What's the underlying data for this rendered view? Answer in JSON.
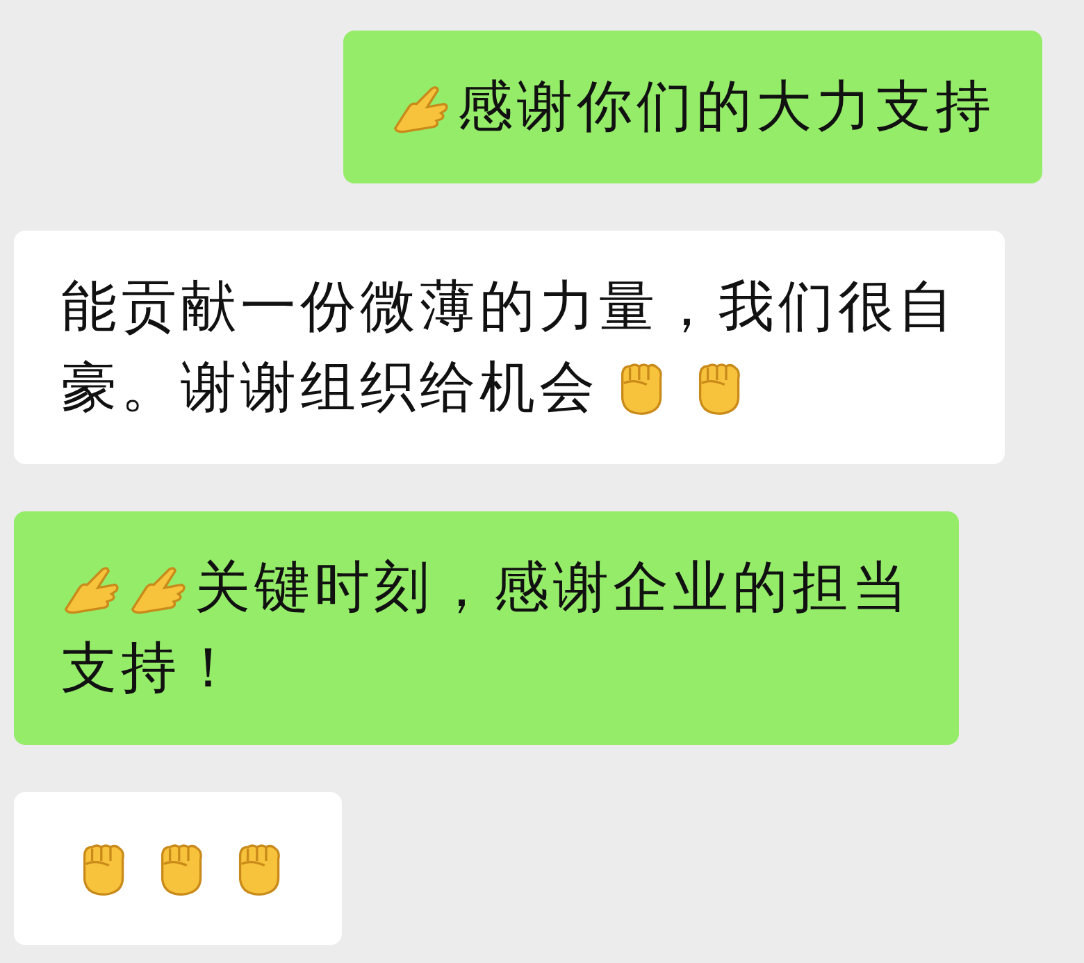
{
  "messages": [
    {
      "align_right": true,
      "color": "#95ec69",
      "lines": [
        [
          {
            "kind": "hand-emoji"
          },
          {
            "kind": "text",
            "text": "感谢你们的大力支持"
          }
        ]
      ]
    },
    {
      "align_right": false,
      "color": "#ffffff",
      "lines": [
        [
          {
            "kind": "text",
            "text": "能贡献一份微薄的力量，我们很自"
          }
        ],
        [
          {
            "kind": "text",
            "text": "豪。谢谢组织给机会"
          },
          {
            "kind": "fist-emoji"
          },
          {
            "kind": "fist-emoji"
          }
        ]
      ]
    },
    {
      "align_right": false,
      "color": "#95ec69",
      "lines": [
        [
          {
            "kind": "hand-emoji"
          },
          {
            "kind": "hand-emoji"
          },
          {
            "kind": "text",
            "text": "关键时刻，感谢企业的担当"
          }
        ],
        [
          {
            "kind": "text",
            "text": "支持！"
          }
        ]
      ]
    },
    {
      "align_right": false,
      "color": "#ffffff",
      "lines": [
        [
          {
            "kind": "fist-emoji"
          },
          {
            "kind": "fist-emoji"
          },
          {
            "kind": "fist-emoji"
          }
        ]
      ]
    }
  ]
}
